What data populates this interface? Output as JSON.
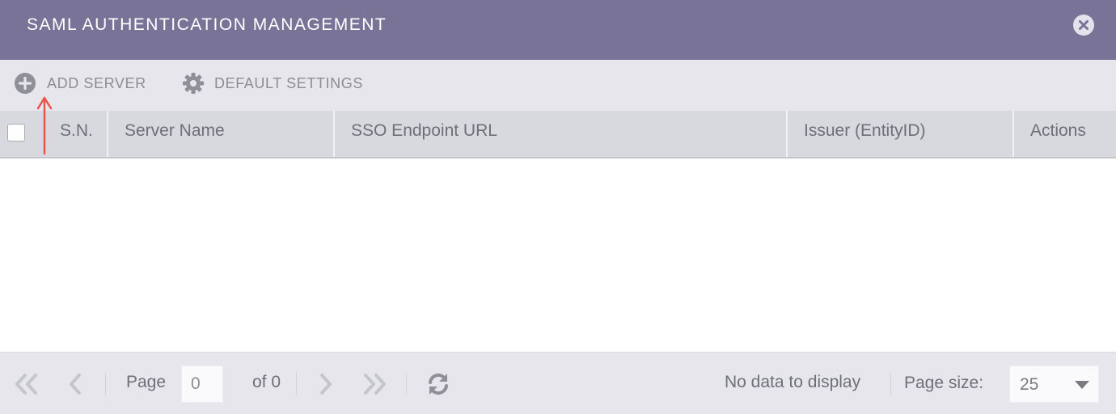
{
  "dialog": {
    "title": "SAML AUTHENTICATION MANAGEMENT",
    "close_icon": "close-circle-icon"
  },
  "toolbar": {
    "add_server_label": "ADD SERVER",
    "add_server_icon": "plus-circle-icon",
    "default_settings_label": "DEFAULT SETTINGS",
    "default_settings_icon": "gear-icon"
  },
  "grid": {
    "columns": [
      {
        "label": "S.N."
      },
      {
        "label": "Server Name"
      },
      {
        "label": "SSO Endpoint URL"
      },
      {
        "label": "Issuer (EntityID)"
      },
      {
        "label": "Actions"
      }
    ],
    "rows": []
  },
  "pager": {
    "page_label": "Page",
    "page_value": "0",
    "of_label": "of 0",
    "status": "No data to display",
    "page_size_label": "Page size:",
    "page_size_value": "25"
  },
  "colors": {
    "titlebar": "#7a7398",
    "toolbar": "#e6e6ec",
    "header": "#d8d8df",
    "annotation_arrow": "#e8584a"
  }
}
